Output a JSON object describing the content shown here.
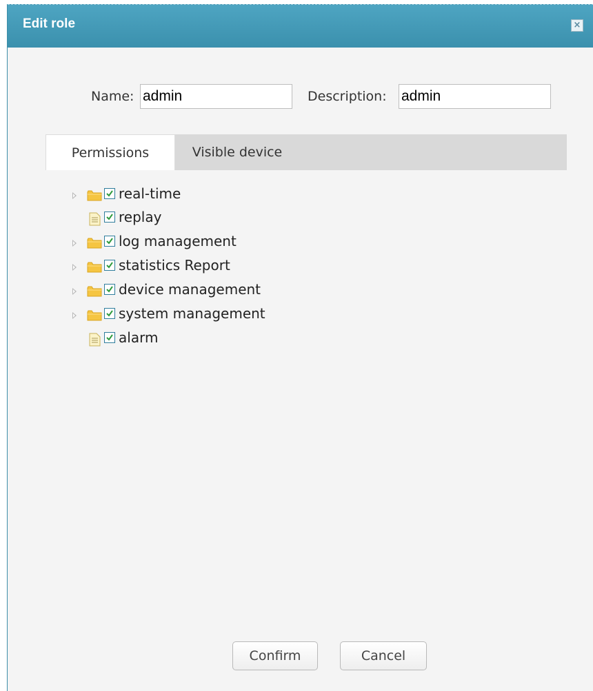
{
  "dialog": {
    "title": "Edit role",
    "close_icon": "close-icon"
  },
  "form": {
    "name_label": "Name:",
    "name_value": "admin",
    "description_label": "Description:",
    "description_value": "admin"
  },
  "tabs": [
    {
      "label": "Permissions",
      "active": true
    },
    {
      "label": "Visible device",
      "active": false
    }
  ],
  "tree": {
    "nodes": [
      {
        "label": "real-time",
        "type": "folder",
        "expandable": true,
        "checked": true
      },
      {
        "label": "replay",
        "type": "file",
        "expandable": false,
        "checked": true
      },
      {
        "label": "log management",
        "type": "folder",
        "expandable": true,
        "checked": true
      },
      {
        "label": "statistics Report",
        "type": "folder",
        "expandable": true,
        "checked": true
      },
      {
        "label": "device management",
        "type": "folder",
        "expandable": true,
        "checked": true
      },
      {
        "label": "system management",
        "type": "folder",
        "expandable": true,
        "checked": true
      },
      {
        "label": "alarm",
        "type": "file",
        "expandable": false,
        "checked": true
      }
    ]
  },
  "buttons": {
    "confirm_label": "Confirm",
    "cancel_label": "Cancel"
  },
  "colors": {
    "title_bar": "#4199b6",
    "check_mark": "#2e9a3c",
    "folder": "#f5c542"
  }
}
